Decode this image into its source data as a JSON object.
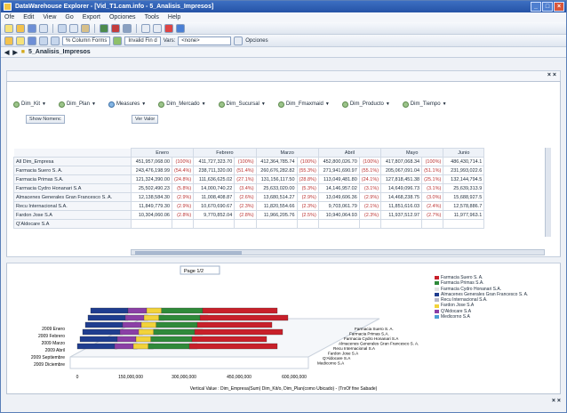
{
  "window": {
    "title": "DataWarehouse Explorer - [Vid_T1.cam.info - 5_Analisis_Impresos]"
  },
  "menu": [
    "Ofe",
    "Edit",
    "View",
    "Go",
    "Export",
    "Opciones",
    "Tools",
    "Help"
  ],
  "toolbar": {
    "combo1": "% Column Forms",
    "combo2": "Invalid Fin d",
    "combo3": "Vars:",
    "combo4": "<none>",
    "text1": "Opciones"
  },
  "address": {
    "path": "5_Analisis_Impresos"
  },
  "panel": {
    "header": "",
    "close": "× ×"
  },
  "dims": [
    {
      "label": "Dim_Kit"
    },
    {
      "label": "Dim_Plan"
    },
    {
      "label": "Measures"
    },
    {
      "label": "Dim_Mercado"
    },
    {
      "label": "Dim_Sucursal"
    },
    {
      "label": "Dim_Fmaxmaid"
    },
    {
      "label": "Dim_Producto"
    },
    {
      "label": "Dim_Tiempo"
    }
  ],
  "buttons": {
    "rows": "Show Nomenc",
    "values": "Ver Valor"
  },
  "table": {
    "months": [
      "Enero",
      "Febrero",
      "Marzo",
      "Abril",
      "Mayo",
      "Junio"
    ],
    "rows": [
      {
        "label": "All Dim_Empresa",
        "cells": [
          "451,957,068.00",
          "(100%)",
          "411,727,323.70",
          "(100%)",
          "412,364,785.74",
          "(100%)",
          "452,800,026.70",
          "(100%)",
          "417,807,068.34",
          "(100%)",
          "486,430,714.1"
        ]
      },
      {
        "label": "Farmacia Suero S. A.",
        "cells": [
          "243,476,198.99",
          "(54.4%)",
          "238,711,320.00",
          "(51.4%)",
          "260,676,282.82",
          "(55.3%)",
          "271,941,690.97",
          "(55.1%)",
          "205,067,091.04",
          "(51.1%)",
          "231,993,022.6"
        ]
      },
      {
        "label": "Farmacia Primas S.A.",
        "cells": [
          "121,324,390.00",
          "(24.8%)",
          "111,636,625.02",
          "(27.1%)",
          "131,156,117.50",
          "(28.8%)",
          "113,049,481.80",
          "(24.1%)",
          "127,818,451.38",
          "(25.1%)",
          "132,144,794.5"
        ]
      },
      {
        "label": "Farmacia Cydro Honanari S.A",
        "cells": [
          "25,502,490.23",
          "(5.8%)",
          "14,000,740.22",
          "(3.4%)",
          "25,633,020.00",
          "(5.3%)",
          "14,146,957.02",
          "(3.1%)",
          "14,649,096.73",
          "(3.1%)",
          "25,639,313.9"
        ]
      },
      {
        "label": "Almacenes Generales Gran Francesco S. A.",
        "cells": [
          "12,138,584.30",
          "(2.9%)",
          "11,008,408.87",
          "(2.6%)",
          "13,680,514.27",
          "(2.9%)",
          "13,049,606.36",
          "(2.9%)",
          "14,468,238.75",
          "(3.0%)",
          "15,688,927.5"
        ]
      },
      {
        "label": "Recu Internacional S.A.",
        "cells": [
          "11,849,779.30",
          "(2.9%)",
          "10,670,690.67",
          "(2.3%)",
          "11,820,554.66",
          "(2.3%)",
          "9,703,061.79",
          "(2.1%)",
          "11,851,616.03",
          "(2.4%)",
          "12,578,886.7"
        ]
      },
      {
        "label": "Fardon Jose S.A",
        "cells": [
          "10,304,060.06",
          "(2.8%)",
          "9,770,852.04",
          "(2.8%)",
          "11,966,205.76",
          "(2.5%)",
          "10,940,064.93",
          "(2.3%)",
          "11,937,512.97",
          "(2.7%)",
          "11,977,963.1"
        ]
      },
      {
        "label": "Q'Aldocare S.A",
        "cells": [
          "",
          "",
          "",
          "",
          "",
          "",
          "",
          "",
          "",
          "",
          ""
        ]
      }
    ]
  },
  "chart": {
    "selector": "Page 1/2",
    "caption": "Vertical Value : Dim_Empresa(Sum) Dim_Kit/o, Dim_Plan(como Ubicado) - (TrxOf fine Sabade)",
    "xlabels": [
      "0",
      "150,000,000",
      "300,000,000",
      "450,000,000",
      "600,000,000"
    ],
    "ylabels": [
      "2009 Enero",
      "2009 Febrero",
      "2009 Marzo",
      "2009 Abril",
      "2009 Septiembre",
      "2009 Diciembre"
    ],
    "series": [
      {
        "name": "Farmacia Suero S. A.",
        "color": "#c8202a"
      },
      {
        "name": "Farmacia Primas S.A.",
        "color": "#2f8a3a"
      },
      {
        "name": "Farmacia Cydro Honanari S.A.",
        "color": "#e3e3e3"
      },
      {
        "name": "Almacenes Generales Gran Francesco S. A.",
        "color": "#1f3d8f"
      },
      {
        "name": "Recu Internacional S.A.",
        "color": "#b7b7c7"
      },
      {
        "name": "Fardon Jose S.A",
        "color": "#f2d33b"
      },
      {
        "name": "Q'Aldocare S.A",
        "color": "#8b3fa6"
      },
      {
        "name": "Medicorno S.A",
        "color": "#4a9fd4"
      }
    ],
    "side_labels": [
      "Farmacia Suero S. A.",
      "Farmacia Primas S.A.",
      "Farmacia Cydro Honanari S.A",
      "Almacenes Generales Gran Francesco S. A.",
      "Recu Internacional S.A",
      "Fardon Jose S.A",
      "Q'Aldocare S.A",
      "Medicorno S.A"
    ]
  }
}
